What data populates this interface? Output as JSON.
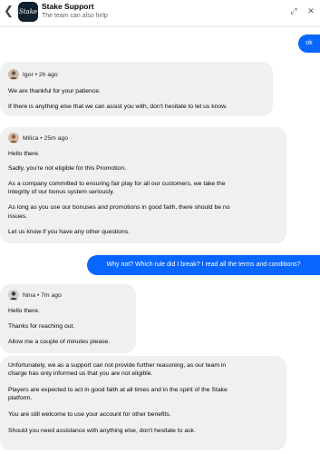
{
  "header": {
    "back_icon": "chevron-left-icon",
    "logo_text": "Stake",
    "title": "Stake Support",
    "subtitle": "The team can also help",
    "actions": [
      "expand-icon",
      "close-icon"
    ]
  },
  "messages": {
    "out1": "ok",
    "igor": {
      "author": "Igor",
      "time": "2h ago",
      "lines": [
        "We are thankful for your patience.",
        "If there is anything else that we can assist you with, don't hesitate to let us know."
      ]
    },
    "milica": {
      "author": "Milica",
      "time": "25m ago",
      "lines": [
        "Hello there.",
        "Sadly, you're not eligible for this Promotion.",
        "As a company committed to ensuring fair play for all our customers, we take the",
        "integrity of our bonus system seriously.",
        "As long as you use our bonuses and promotions in good faith, there should be no",
        "issues.",
        "Let us know if you have any other questions."
      ]
    },
    "out2": "Why not? Which rule did I break? I read all the terms and conditions?",
    "nina": {
      "author": "Nina",
      "time": "7m ago",
      "lines": [
        "Hello there.",
        "Thanks for reaching out.",
        "Allow me a couple of minutes please."
      ]
    },
    "final": {
      "lines": [
        "Unfortunately, we as a support can not provide further reasoning, as our team in",
        "charge has only informed us that you are not eligible.",
        "Players are expected to act in good faith at all times and in the spirit of the Stake",
        "platform.",
        "You are still welcome to use your account for other benefits.",
        "Should you need assistance with anything else, don't hesitate to ask."
      ]
    }
  },
  "colors": {
    "outgoing": "#0866ff",
    "incoming": "#f0f0f0",
    "logo_bg": "#0f212e"
  }
}
